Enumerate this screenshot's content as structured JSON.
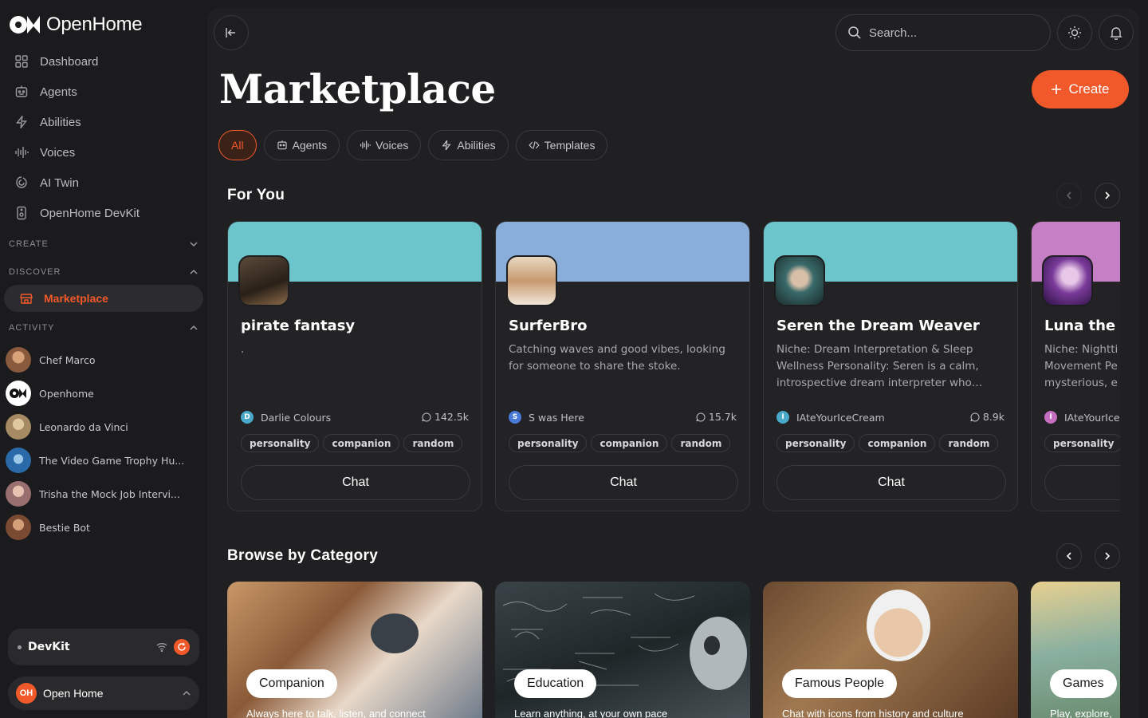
{
  "app": {
    "name": "OpenHome"
  },
  "sidebar": {
    "nav": [
      {
        "label": "Dashboard",
        "icon": "grid-icon"
      },
      {
        "label": "Agents",
        "icon": "agent-icon"
      },
      {
        "label": "Abilities",
        "icon": "bolt-icon"
      },
      {
        "label": "Voices",
        "icon": "waveform-icon"
      },
      {
        "label": "AI Twin",
        "icon": "twin-icon"
      },
      {
        "label": "OpenHome DevKit",
        "icon": "devkit-icon"
      }
    ],
    "sections": {
      "create": "CREATE",
      "discover": "DISCOVER",
      "activity": "ACTIVITY"
    },
    "discover_items": [
      {
        "label": "Marketplace",
        "icon": "store-icon"
      }
    ],
    "activity": [
      {
        "label": "Chef Marco",
        "color": "#8a5a3c"
      },
      {
        "label": "Openhome",
        "color": "#ffffff"
      },
      {
        "label": "Leonardo da Vinci",
        "color": "#a58a63"
      },
      {
        "label": "The Video Game Trophy Hu...",
        "color": "#2a6aa8"
      },
      {
        "label": "Trisha the Mock Job Intervi...",
        "color": "#9a6f6f"
      },
      {
        "label": "Bestie Bot",
        "color": "#7a4a32"
      }
    ],
    "devkit": {
      "label": "DevKit"
    },
    "user": {
      "initials": "OH",
      "label": "Open Home"
    }
  },
  "header": {
    "search_placeholder": "Search..."
  },
  "page": {
    "title": "Marketplace",
    "create_label": "Create",
    "filters": [
      {
        "label": "All",
        "active": true
      },
      {
        "label": "Agents",
        "icon": "agent-icon"
      },
      {
        "label": "Voices",
        "icon": "waveform-icon"
      },
      {
        "label": "Abilities",
        "icon": "bolt-icon"
      },
      {
        "label": "Templates",
        "icon": "code-icon"
      }
    ]
  },
  "for_you": {
    "title": "For You",
    "cards": [
      {
        "name": "pirate fantasy",
        "desc": ".",
        "author": "Darlie Colours",
        "author_initial": "D",
        "author_color": "#4aa8c8",
        "count": "142.5k",
        "banner": "#6bc5cb",
        "tags": [
          "personality",
          "companion",
          "random"
        ],
        "chat": "Chat"
      },
      {
        "name": "SurferBro",
        "desc": "Catching waves and good vibes, looking for someone to share the stoke.",
        "author": "S was Here",
        "author_initial": "S",
        "author_color": "#4a7ad8",
        "count": "15.7k",
        "banner": "#88aed9",
        "tags": [
          "personality",
          "companion",
          "random"
        ],
        "chat": "Chat"
      },
      {
        "name": "Seren the Dream Weaver",
        "desc": "Niche: Dream Interpretation & Sleep Wellness Personality: Seren is a calm, introspective dream interpreter who…",
        "author": "IAteYourIceCream",
        "author_initial": "I",
        "author_color": "#4aa8c8",
        "count": "8.9k",
        "banner": "#6bc5cb",
        "tags": [
          "personality",
          "companion",
          "random"
        ],
        "chat": "Chat"
      },
      {
        "name": "Luna the M",
        "desc": "Niche: Nightti Movement Pe mysterious, e",
        "author": "IAteYourIce",
        "author_initial": "I",
        "author_color": "#c46fc0",
        "count": "",
        "banner": "#c67ec4",
        "tags": [
          "personality"
        ],
        "chat": ""
      }
    ]
  },
  "browse": {
    "title": "Browse by Category",
    "categories": [
      {
        "label": "Companion",
        "sub": "Always here to talk, listen, and connect"
      },
      {
        "label": "Education",
        "sub": "Learn anything, at your own pace"
      },
      {
        "label": "Famous People",
        "sub": "Chat with icons from history and culture"
      },
      {
        "label": "Games",
        "sub": "Play, explore,"
      }
    ]
  }
}
